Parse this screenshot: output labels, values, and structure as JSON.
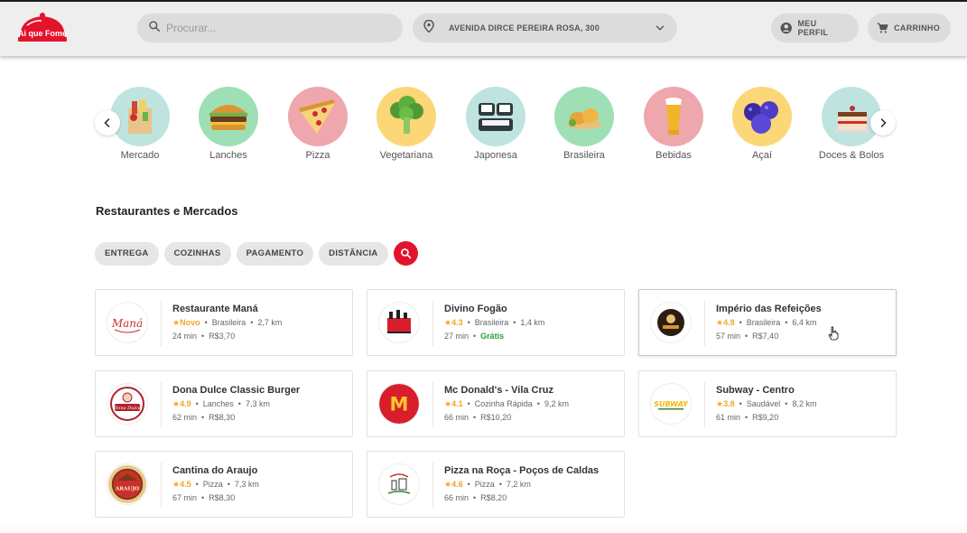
{
  "header": {
    "logo_text": "Ai que Fome",
    "search_placeholder": "Procurar...",
    "address": "AVENIDA DIRCE PEREIRA ROSA, 300",
    "profile_label": "MEU PERFIL",
    "cart_label": "CARRINHO",
    "brand_color": "#e4132c"
  },
  "categories": [
    {
      "label": "Mercado",
      "bg": "#bfe4df",
      "icon": "grocery-bag-icon"
    },
    {
      "label": "Lanches",
      "bg": "#9fdfb5",
      "icon": "burger-icon"
    },
    {
      "label": "Pizza",
      "bg": "#eea7ac",
      "icon": "pizza-icon"
    },
    {
      "label": "Vegetariana",
      "bg": "#fbd777",
      "icon": "broccoli-icon"
    },
    {
      "label": "Japonesa",
      "bg": "#bfe4df",
      "icon": "sushi-icon"
    },
    {
      "label": "Brasileira",
      "bg": "#9fdfb5",
      "icon": "chicken-icon"
    },
    {
      "label": "Bebidas",
      "bg": "#eea7ac",
      "icon": "beer-icon"
    },
    {
      "label": "Açaí",
      "bg": "#fbd777",
      "icon": "acai-icon"
    },
    {
      "label": "Doces & Bolos",
      "bg": "#bfe4df",
      "icon": "cake-icon"
    }
  ],
  "section": {
    "title": "Restaurantes e Mercados",
    "filters": [
      "ENTREGA",
      "COZINHAS",
      "PAGAMENTO",
      "DISTÂNCIA"
    ]
  },
  "restaurants": [
    {
      "name": "Restaurante Maná",
      "rating": "Novo",
      "cuisine": "Brasileira",
      "distance": "2,7 km",
      "time": "24 min",
      "fee": "R$3,70",
      "logo": "mana-logo",
      "logo_text": "Maná"
    },
    {
      "name": "Divino Fogão",
      "rating": "4.3",
      "cuisine": "Brasileira",
      "distance": "1,4 km",
      "time": "27 min",
      "fee": "Grátis",
      "logo": "divino-fogao-logo"
    },
    {
      "name": "Império das Refeições",
      "rating": "4.8",
      "cuisine": "Brasileira",
      "distance": "6,4 km",
      "time": "57 min",
      "fee": "R$7,40",
      "logo": "imperio-logo"
    },
    {
      "name": "Dona Dulce Classic Burger",
      "rating": "4.9",
      "cuisine": "Lanches",
      "distance": "7,3 km",
      "time": "62 min",
      "fee": "R$8,30",
      "logo": "dona-dulce-logo",
      "logo_text": "Dona Dulce"
    },
    {
      "name": "Mc Donald's - Vila Cruz",
      "rating": "4.1",
      "cuisine": "Cozinha Rápida",
      "distance": "9,2 km",
      "time": "66 min",
      "fee": "R$10,20",
      "logo": "mcdonalds-logo",
      "logo_text": "M"
    },
    {
      "name": "Subway - Centro",
      "rating": "3.8",
      "cuisine": "Saudável",
      "distance": "8,2 km",
      "time": "61 min",
      "fee": "R$9,20",
      "logo": "subway-logo",
      "logo_text": "SUBWAY"
    },
    {
      "name": "Cantina do Araujo",
      "rating": "4.5",
      "cuisine": "Pizza",
      "distance": "7,3 km",
      "time": "67 min",
      "fee": "R$8,30",
      "logo": "cantina-logo",
      "logo_text": "ARAUJO"
    },
    {
      "name": "Pizza na Roça - Poços de Caldas",
      "rating": "4.6",
      "cuisine": "Pizza",
      "distance": "7,2 km",
      "time": "66 min",
      "fee": "R$8,20",
      "logo": "pizza-roca-logo"
    }
  ]
}
